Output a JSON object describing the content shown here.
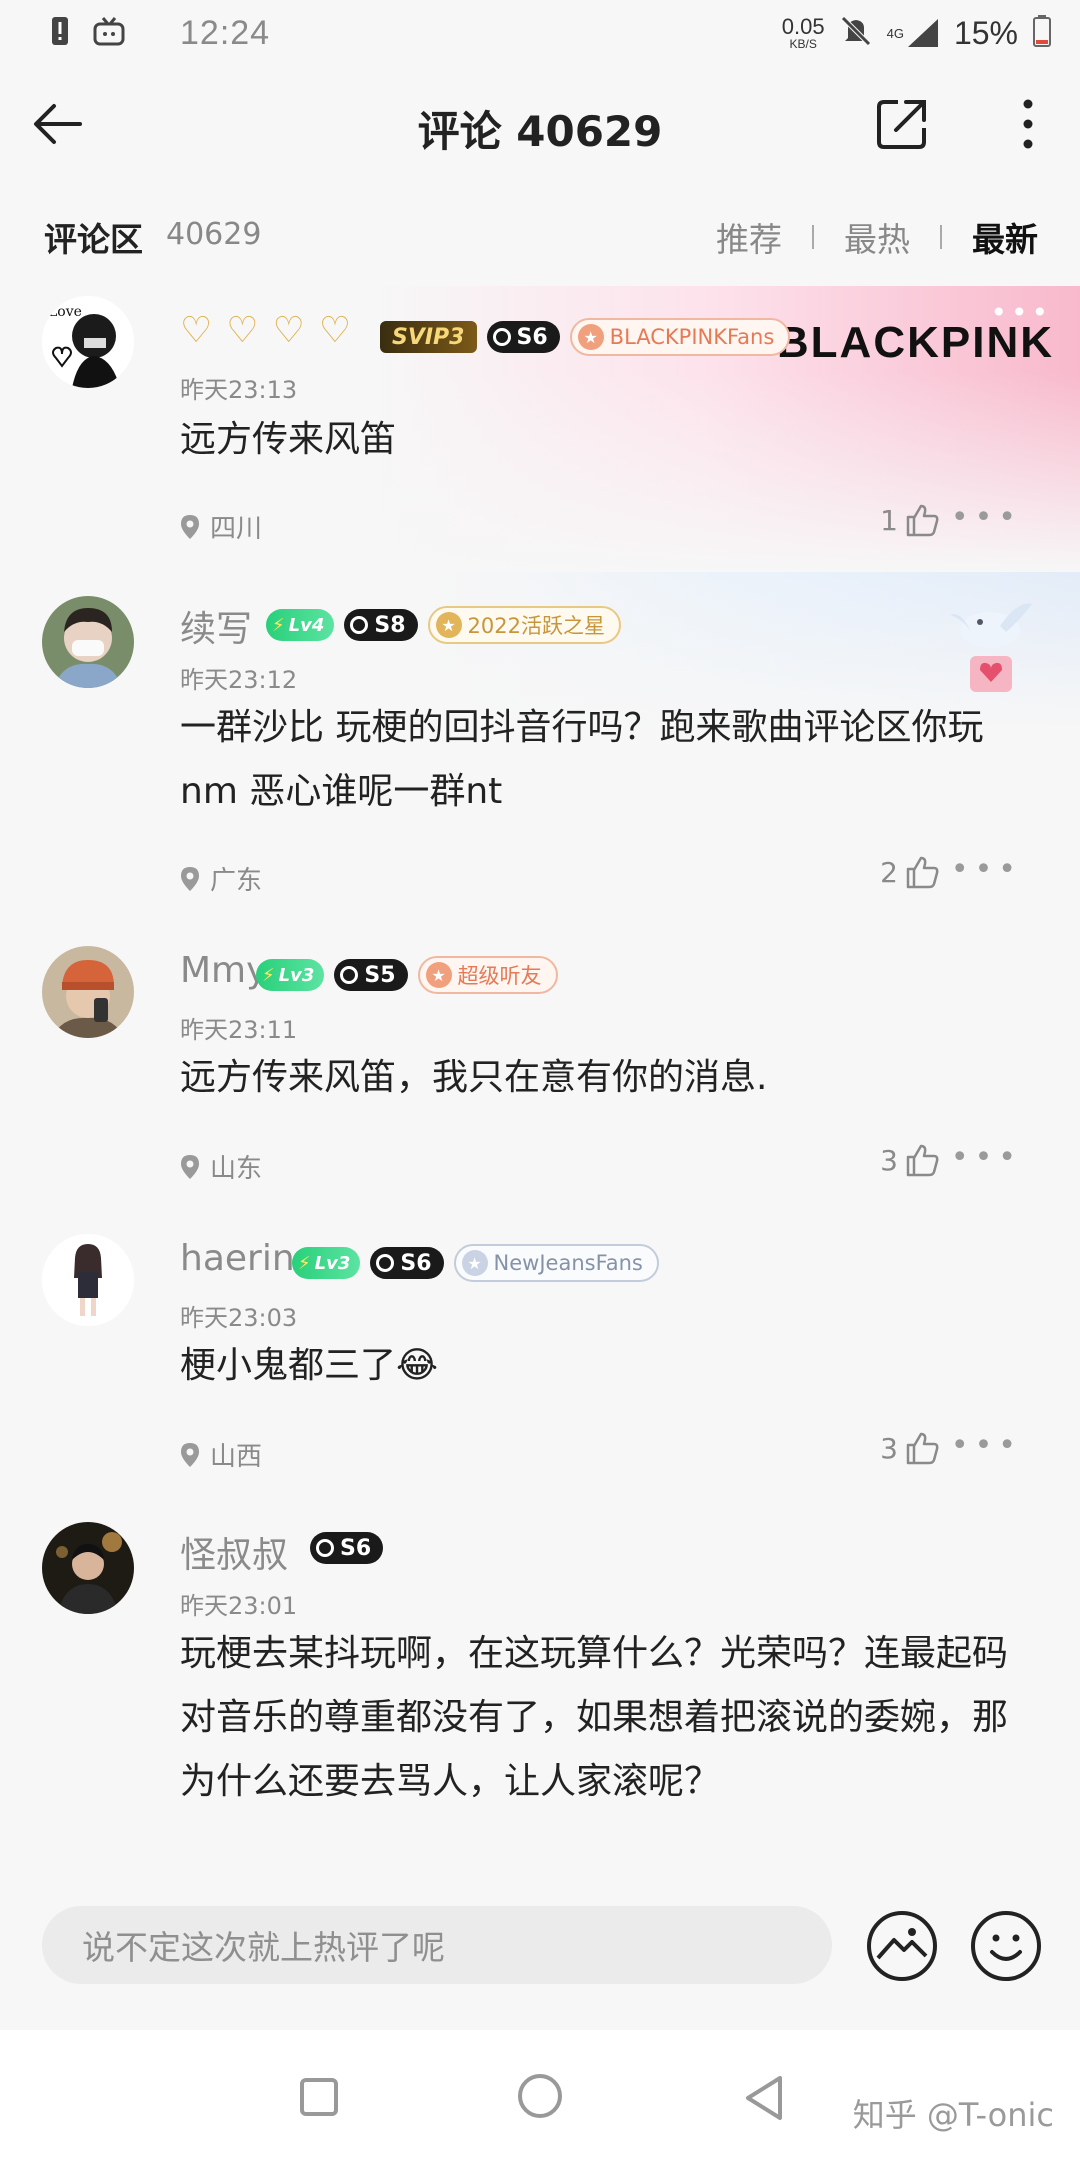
{
  "status_bar": {
    "time": "12:24",
    "net_speed": "0.05",
    "net_unit": "KB/S",
    "network": "4G",
    "battery": "15%"
  },
  "header": {
    "title": "评论 40629"
  },
  "filter": {
    "label": "评论区",
    "count": "40629",
    "sort_options": [
      "推荐",
      "最热",
      "最新"
    ],
    "active_sort": "最新"
  },
  "comments": [
    {
      "name": "",
      "badges": {
        "vip": "SVIP3",
        "season": "S6",
        "fan": "BLACKPINKFans"
      },
      "banner_text": "BLACKPINK",
      "time": "昨天23:13",
      "text": "远方传来风笛",
      "location": "四川",
      "likes": "1"
    },
    {
      "name": "续写",
      "badges": {
        "level": "Lv4",
        "season": "S8",
        "fan": "2022活跃之星"
      },
      "time": "昨天23:12",
      "text": "一群沙比 玩梗的回抖音行吗？跑来歌曲评论区你玩nm 恶心谁呢一群nt",
      "location": "广东",
      "likes": "2"
    },
    {
      "name": "Mmy",
      "badges": {
        "level": "Lv3",
        "season": "S5",
        "fan": "超级听友"
      },
      "time": "昨天23:11",
      "text": "远方传来风笛，我只在意有你的消息.",
      "location": "山东",
      "likes": "3"
    },
    {
      "name": "haerin",
      "badges": {
        "level": "Lv3",
        "season": "S6",
        "fan": "NewJeansFans"
      },
      "time": "昨天23:03",
      "text": "梗小鬼都三了😂",
      "location": "山西",
      "likes": "3"
    },
    {
      "name": "怪叔叔",
      "badges": {
        "season": "S6"
      },
      "time": "昨天23:01",
      "text": "玩梗去某抖玩啊，在这玩算什么？光荣吗？连最起码对音乐的尊重都没有了，如果想着把滚说的委婉，那为什么还要去骂人，让人家滚呢？",
      "location": "",
      "likes": ""
    }
  ],
  "input": {
    "placeholder": "说不定这次就上热评了呢"
  },
  "watermark": "知乎 @T-onic",
  "icons": {
    "back": "arrow-left-icon",
    "share": "share-icon",
    "more": "more-vertical-icon",
    "location": "location-pin-icon",
    "like": "thumbs-up-icon",
    "image": "image-icon",
    "emoji": "emoji-icon"
  },
  "colors": {
    "background": "#f7f7f7",
    "level_badge": "#28d07a",
    "muted_text": "#8a8a8a"
  }
}
